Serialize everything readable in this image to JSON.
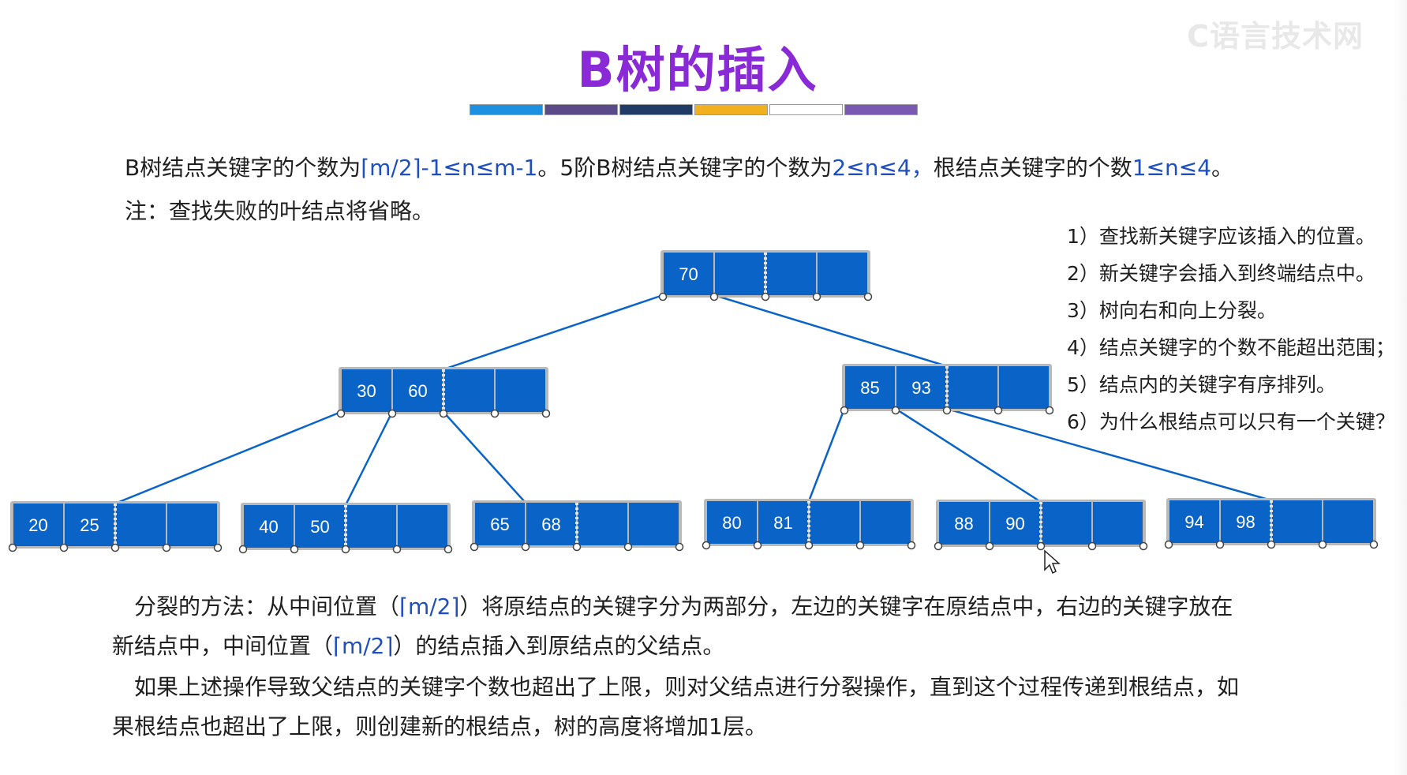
{
  "watermark": "C语言技术网",
  "title": "B树的插入",
  "title_bar_colors": [
    "#1e90e0",
    "#5a4a8a",
    "#1f3b66",
    "#f0b020",
    "#ffffff",
    "#7a5ab0"
  ],
  "intro": {
    "p1_a": "B树结点关键字的个数为",
    "p1_f1": "⌈m/2⌉-1≤n≤m-1",
    "p1_b": "。5阶B树结点关键字的个数为",
    "p1_f2": "2≤n≤4，",
    "p1_c": "根结点关键字的个数",
    "p1_f3": "1≤n≤4",
    "p1_d": "。",
    "note": "注：查找失败的叶结点将省略。"
  },
  "steps": [
    "1）查找新关键字应该插入的位置。",
    "2）新关键字会插入到终端结点中。",
    "3）树向右和向上分裂。",
    "4）结点关键字的个数不能超出范围；",
    "5）结点内的关键字有序排列。",
    "6）为什么根结点可以只有一个关键？"
  ],
  "tree": {
    "node_color": "#0a64c8",
    "root": {
      "keys": [
        "70",
        "",
        "",
        ""
      ]
    },
    "level1": [
      {
        "keys": [
          "30",
          "60",
          "",
          ""
        ]
      },
      {
        "keys": [
          "85",
          "93",
          "",
          ""
        ]
      }
    ],
    "leaves": [
      {
        "keys": [
          "20",
          "25",
          "",
          ""
        ]
      },
      {
        "keys": [
          "40",
          "50",
          "",
          ""
        ]
      },
      {
        "keys": [
          "65",
          "68",
          "",
          ""
        ]
      },
      {
        "keys": [
          "80",
          "81",
          "",
          ""
        ]
      },
      {
        "keys": [
          "88",
          "90",
          "",
          ""
        ]
      },
      {
        "keys": [
          "94",
          "98",
          "",
          ""
        ]
      }
    ]
  },
  "split_text": {
    "p1_a": "分裂的方法：从中间位置（",
    "p1_f": "⌈m/2⌉",
    "p1_b": "）将原结点的关键字分为两部分，左边的关键字在原结点中，右边的关键字放在新结点中，中间位置（",
    "p1_f2": "⌈m/2⌉",
    "p1_c": "）的结点插入到原结点的父结点。",
    "p2": "如果上述操作导致父结点的关键字个数也超出了上限，则对父结点进行分裂操作，直到这个过程传递到根结点，如果根结点也超出了上限，则创建新的根结点，树的高度将增加1层。"
  }
}
